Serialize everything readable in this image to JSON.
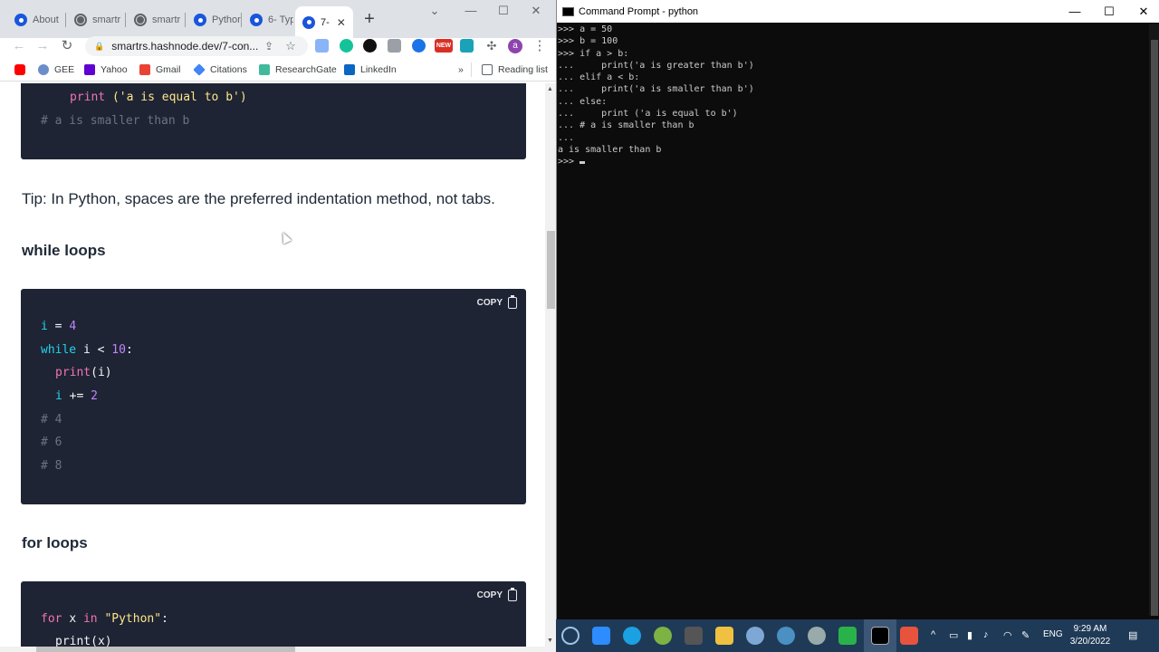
{
  "browser": {
    "tabs": [
      {
        "label": "About",
        "favicon": "blue"
      },
      {
        "label": "smartr",
        "favicon": "grey"
      },
      {
        "label": "smartr",
        "favicon": "grey"
      },
      {
        "label": "Pythor",
        "favicon": "blue"
      },
      {
        "label": "6- Typ",
        "favicon": "blue"
      },
      {
        "label": "7-",
        "favicon": "blue",
        "active": true
      }
    ],
    "new_tab": "+",
    "url": "smartrs.hashnode.dev/7-con...",
    "bookmarks": [
      "GEE",
      "Yahoo",
      "Gmail",
      "Citations",
      "ResearchGate",
      "LinkedIn"
    ],
    "bookmarks_overflow": "»",
    "reading_list": "Reading list",
    "ext_badge": "NEW",
    "profile_initial": "a"
  },
  "page": {
    "block1": {
      "lines": [
        "print ('a is equal to b')",
        "# a is smaller than b"
      ]
    },
    "tip": "Tip: In Python, spaces are the preferred indentation method, not tabs.",
    "heading_while": "while loops",
    "copy_label": "COPY",
    "block2": {
      "lines": [
        "i = 4",
        "while i < 10:",
        "print(i)",
        "i += 2",
        "# 4",
        "# 6",
        "# 8"
      ]
    },
    "heading_for": "for loops",
    "block3": {
      "lines": [
        "for x in \"Python\":",
        "print(x)"
      ]
    }
  },
  "cmd": {
    "title": "Command Prompt - python",
    "lines": [
      ">>> a = 50",
      ">>> b = 100",
      ">>> if a > b:",
      "...     print('a is greater than b')",
      "... elif a < b:",
      "...     print('a is smaller than b')",
      "... else:",
      "...     print ('a is equal to b')",
      "... # a is smaller than b",
      "...",
      "a is smaller than b",
      ">>> "
    ]
  },
  "taskbar": {
    "lang": "ENG",
    "time": "9:29 AM",
    "date": "3/20/2022"
  },
  "colors": {
    "code_bg": "#1e2433",
    "keyword": "#22d3ee",
    "function": "#f472b6",
    "string": "#fde68a",
    "number": "#c084fc",
    "comment": "#6b7280",
    "taskbar": "#1f3a57"
  }
}
